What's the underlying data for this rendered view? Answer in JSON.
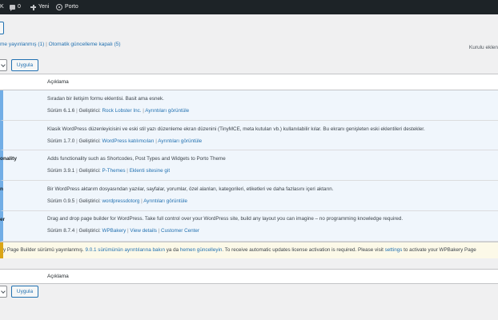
{
  "adminbar": {
    "site_fragment": "K",
    "comments_count": "0",
    "new_label": "Yeni",
    "theme_label": "Porto",
    "bg_color": "#1d2327"
  },
  "filters": {
    "auto_update_enabled": "me yayınlanmış (1)",
    "separator": "|",
    "auto_update_disabled": "Otomatik güncelleme kapalı (5)"
  },
  "search_label": "Kurulu eklen",
  "bulk": {
    "apply_label": "Uygula"
  },
  "table": {
    "column_description": "Açıklama",
    "rows": [
      {
        "name": "",
        "description": "Sıradan bir iletişim formu eklentisi. Basit ama esnek.",
        "version": "Sürüm 6.1.6",
        "developer_prefix": "Geliştirici:",
        "developer": "Rock Lobster Inc.",
        "details": "Ayrıntıları görüntüle"
      },
      {
        "name": "",
        "description": "Klasik WordPress düzenleyicisini ve eski stil yazı düzenleme ekran düzenini (TinyMCE, meta kutuları vb.) kullanılabilir kılar. Bu ekranı genişleten eski eklentileri destekler.",
        "version": "Sürüm 1.7.0",
        "developer_prefix": "Geliştirici:",
        "developer": "WordPress katılımcıları",
        "details": "Ayrıntıları görüntüle"
      },
      {
        "name": "onality",
        "description": "Adds functionality such as Shortcodes, Post Types and Widgets to Porto Theme",
        "version": "Sürüm 3.9.1",
        "developer_prefix": "Geliştirici:",
        "developer": "P-Themes",
        "details": "Eklenti sitesine git"
      },
      {
        "name": "n",
        "description": "Bir WordPress aktarım dosyasından yazılar, sayfalar, yorumlar, özel alanları, kategorileri, etiketleri ve daha fazlasını içeri aktarın.",
        "version": "Sürüm 0.9.5",
        "developer_prefix": "Geliştirici:",
        "developer": "wordpressdotorg",
        "details": "Ayrıntıları görüntüle"
      },
      {
        "name": "er",
        "description": "Drag and drop page builder for WordPress. Take full control over your WordPress site, build any layout you can imagine – no programming knowledge required.",
        "version": "Sürüm 8.7.4",
        "developer_prefix": "Geliştirici:",
        "developer": "WPBakery",
        "details": "View details",
        "extra": "Customer Center"
      }
    ]
  },
  "notice": {
    "prefix": "y Page Builder sürümü yayınlanmış.",
    "version_link": "9.0.1 sürümünün ayrıntılarına bakın",
    "middle": "ya da",
    "update_link": "hemen güncelleyin",
    "suffix": ". To receive automatic updates license activation is required. Please visit",
    "settings_link": "settings",
    "end": "to activate your WPBakery Page"
  },
  "footer": {
    "column_description": "Açıklama",
    "apply_label": "Uygula"
  },
  "colors": {
    "accent": "#2271b1",
    "notice_border": "#dba617",
    "active_border": "#72aee6"
  }
}
